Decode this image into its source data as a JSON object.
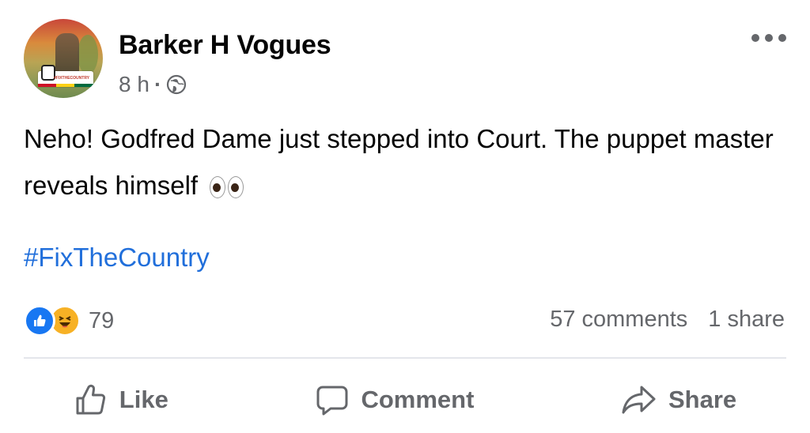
{
  "post": {
    "author": "Barker H Vogues",
    "time": "8 h",
    "separator": "·",
    "privacy_icon": "globe-icon",
    "text": "Neho! Godfred Dame just stepped into Court. The puppet master reveals himself",
    "emoji": "eyes",
    "hashtag": "#FixTheCountry",
    "avatar_badge_text": "#FIXTHECOUNTRY"
  },
  "engagement": {
    "reaction_icons": [
      "like-icon",
      "haha-icon"
    ],
    "reactions_count": "79",
    "comments": "57 comments",
    "shares": "1 share"
  },
  "actions": {
    "like": "Like",
    "comment": "Comment",
    "share": "Share"
  },
  "colors": {
    "link": "#216fdb",
    "muted": "#65676b",
    "like_blue": "#1877f2",
    "haha_yellow": "#f7b125"
  }
}
